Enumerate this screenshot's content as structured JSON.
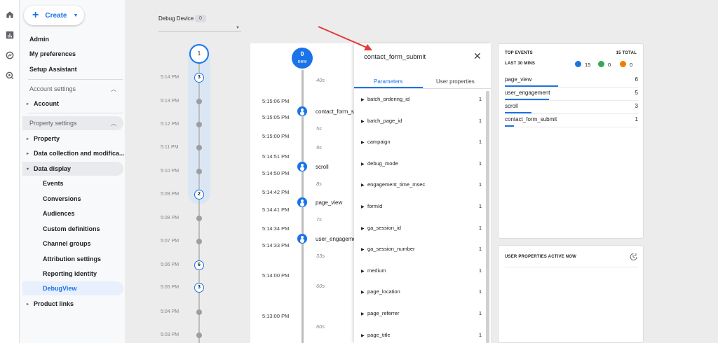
{
  "create": {
    "label": "Create"
  },
  "nav": {
    "admin": "Admin",
    "preferences": "My preferences",
    "setup": "Setup Assistant",
    "account_settings": "Account settings",
    "account": "Account",
    "property_settings": "Property settings",
    "property": "Property",
    "data_collection": "Data collection and modifica...",
    "data_display": "Data display",
    "leaves": [
      "Events",
      "Conversions",
      "Audiences",
      "Custom definitions",
      "Channel groups",
      "Attribution settings",
      "Reporting identity",
      "DebugView"
    ],
    "product_links": "Product links"
  },
  "device": {
    "label": "Debug Device",
    "count": "0"
  },
  "minutes": {
    "top_count": "1",
    "rows": [
      {
        "time": "5:14 PM",
        "badge": "3"
      },
      {
        "time": "5:13 PM",
        "badge": ""
      },
      {
        "time": "5:12 PM",
        "badge": ""
      },
      {
        "time": "5:11 PM",
        "badge": ""
      },
      {
        "time": "5:10 PM",
        "badge": ""
      },
      {
        "time": "5:09 PM",
        "badge": "2"
      },
      {
        "time": "5:08 PM",
        "badge": ""
      },
      {
        "time": "5:07 PM",
        "badge": ""
      },
      {
        "time": "5:06 PM",
        "badge": "6"
      },
      {
        "time": "5:05 PM",
        "badge": "3"
      },
      {
        "time": "5:04 PM",
        "badge": ""
      },
      {
        "time": "5:03 PM",
        "badge": ""
      }
    ]
  },
  "seconds": {
    "top_count": "0",
    "top_label": "new",
    "times": [
      "5:15:06 PM",
      "5:15:05 PM",
      "5:15:00 PM",
      "5:14:51 PM",
      "5:14:50 PM",
      "5:14:42 PM",
      "5:14:41 PM",
      "5:14:34 PM",
      "5:14:33 PM",
      "5:14:00 PM",
      "5:13:00 PM"
    ],
    "gaps": [
      "40s",
      "5s",
      "9s",
      "8s",
      "7s",
      "33s",
      "60s",
      "60s"
    ],
    "events": [
      "contact_form_submit",
      "scroll",
      "page_view",
      "user_engagement"
    ]
  },
  "panel": {
    "title": "contact_form_submit",
    "tabs": [
      "Parameters",
      "User properties"
    ],
    "params": [
      {
        "name": "batch_ordering_id",
        "count": "1"
      },
      {
        "name": "batch_page_id",
        "count": "1"
      },
      {
        "name": "campaign",
        "count": "1"
      },
      {
        "name": "debug_mode",
        "count": "1"
      },
      {
        "name": "engagement_time_msec",
        "count": "1"
      },
      {
        "name": "formId",
        "count": "1"
      },
      {
        "name": "ga_session_id",
        "count": "1"
      },
      {
        "name": "ga_session_number",
        "count": "1"
      },
      {
        "name": "medium",
        "count": "1"
      },
      {
        "name": "page_location",
        "count": "1"
      },
      {
        "name": "page_referrer",
        "count": "1"
      },
      {
        "name": "page_title",
        "count": "1"
      }
    ]
  },
  "top_events": {
    "title": "TOP EVENTS",
    "total": "15 TOTAL",
    "subtitle": "LAST 30 MINS",
    "counts": [
      {
        "value": "15",
        "color": "#1a73e8"
      },
      {
        "value": "0",
        "color": "#34a853"
      },
      {
        "value": "0",
        "color": "#f57c00"
      }
    ],
    "rows": [
      {
        "name": "page_view",
        "value": "6",
        "bar": 0.4
      },
      {
        "name": "user_engagement",
        "value": "5",
        "bar": 0.33
      },
      {
        "name": "scroll",
        "value": "3",
        "bar": 0.2
      },
      {
        "name": "contact_form_submit",
        "value": "1",
        "bar": 0.07
      }
    ]
  },
  "user_props": {
    "title": "USER PROPERTIES ACTIVE NOW"
  }
}
